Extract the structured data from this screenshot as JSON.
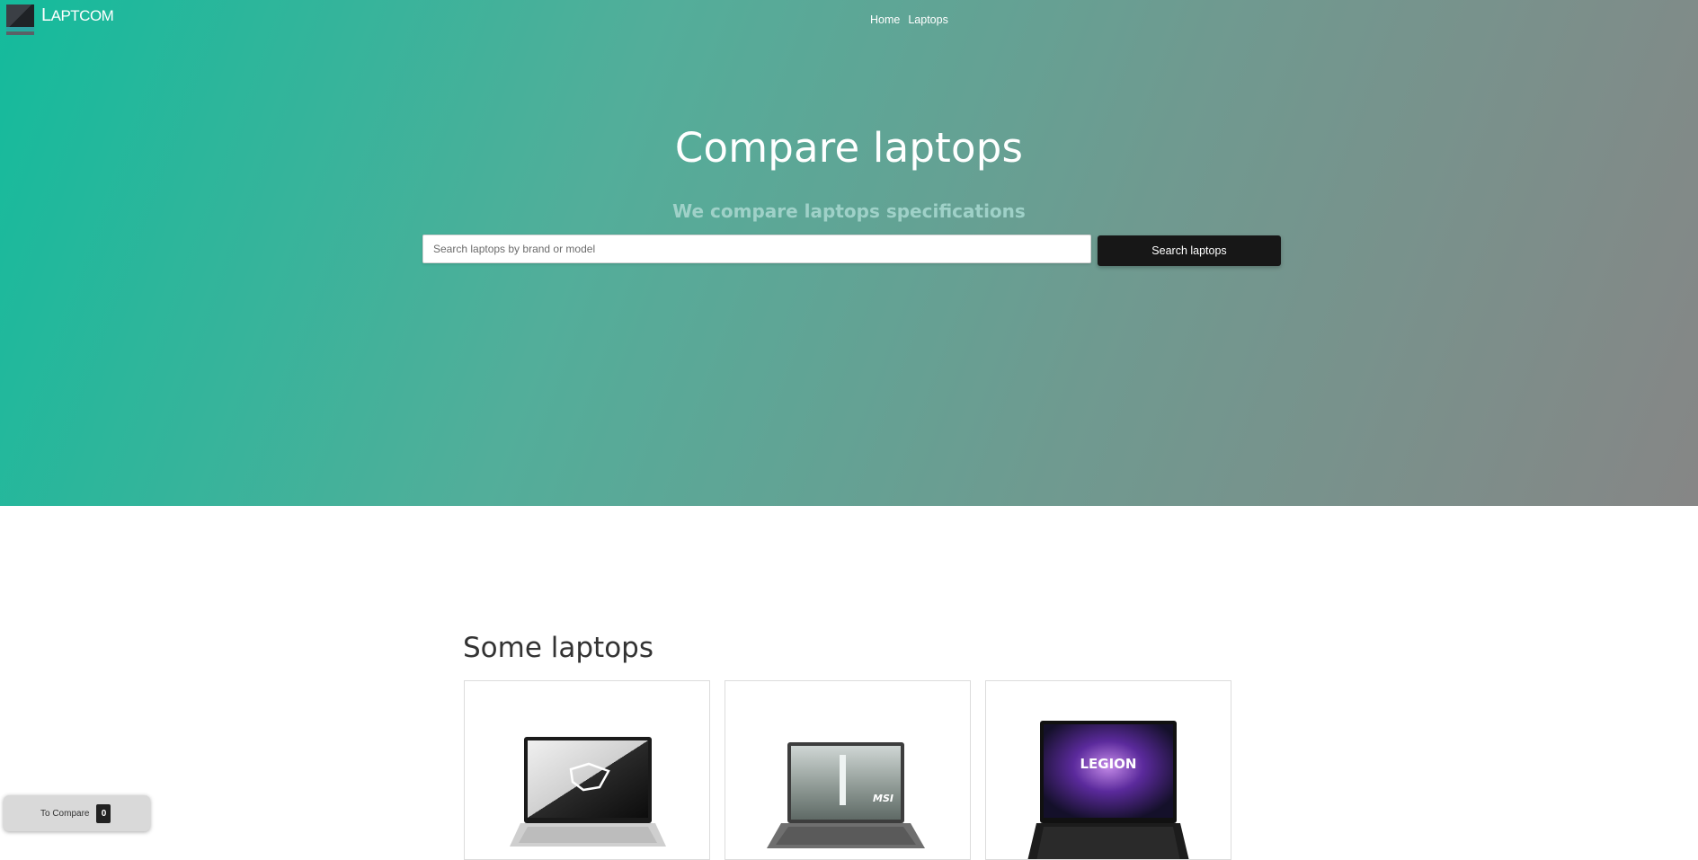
{
  "header": {
    "logo_text_first": "L",
    "logo_text_rest": "APTCOM",
    "nav": [
      {
        "label": "Home"
      },
      {
        "label": "Laptops"
      }
    ]
  },
  "hero": {
    "title": "Compare laptops",
    "subtitle": "We compare laptops specifications",
    "search_placeholder": "Search laptops by brand or model",
    "search_value": "",
    "search_button": "Search laptops"
  },
  "section": {
    "title": "Some laptops"
  },
  "laptops": [
    {
      "brand_mark": "ROG"
    },
    {
      "brand_mark": "MSI"
    },
    {
      "brand_mark": "LEGION"
    }
  ],
  "compare": {
    "label": "To Compare",
    "count": "0"
  },
  "colors": {
    "hero_start": "#14bb9c",
    "hero_end": "#868686",
    "button_bg": "#171717"
  }
}
